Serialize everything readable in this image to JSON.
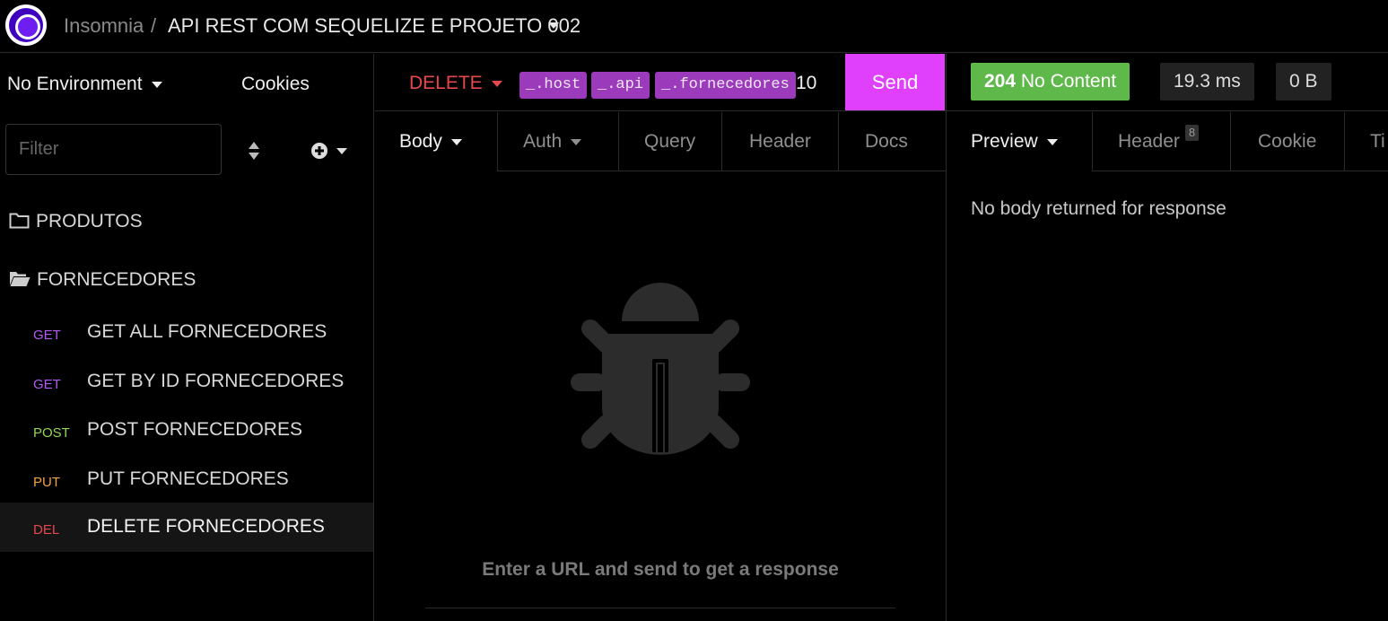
{
  "header": {
    "app_name": "Insomnia",
    "separator": "/",
    "project": "API REST COM SEQUELIZE E PROJETO 002"
  },
  "sidebar": {
    "environment": "No Environment",
    "cookies": "Cookies",
    "filter_placeholder": "Filter",
    "folders": [
      {
        "name": "PRODUTOS"
      },
      {
        "name": "FORNECEDORES"
      }
    ],
    "requests": [
      {
        "method": "GET",
        "name": "GET ALL FORNECEDORES"
      },
      {
        "method": "GET",
        "name": "GET BY ID FORNECEDORES"
      },
      {
        "method": "POST",
        "name": "POST FORNECEDORES"
      },
      {
        "method": "PUT",
        "name": "PUT FORNECEDORES"
      },
      {
        "method": "DEL",
        "name": "DELETE FORNECEDORES"
      }
    ]
  },
  "request": {
    "method": "DELETE",
    "url_vars": [
      "_.host",
      "_.api",
      "_.fornecedores"
    ],
    "url_tail": "10",
    "send_label": "Send",
    "tabs": [
      "Body",
      "Auth",
      "Query",
      "Header",
      "Docs"
    ],
    "empty_hint": "Enter a URL and send to get a response"
  },
  "response": {
    "status_code": "204",
    "status_text": "No Content",
    "time": "19.3 ms",
    "size": "0 B",
    "tabs": [
      "Preview",
      "Header",
      "Cookie",
      "Ti"
    ],
    "header_count": "8",
    "message": "No body returned for response"
  },
  "colors": {
    "send": "#e040fb",
    "status_ok": "#5fb84a",
    "method_delete": "#e5484d",
    "method_get": "#b35cf5",
    "method_post": "#8fd858",
    "method_put": "#f2a33a",
    "url_var": "#9b3bbb"
  }
}
